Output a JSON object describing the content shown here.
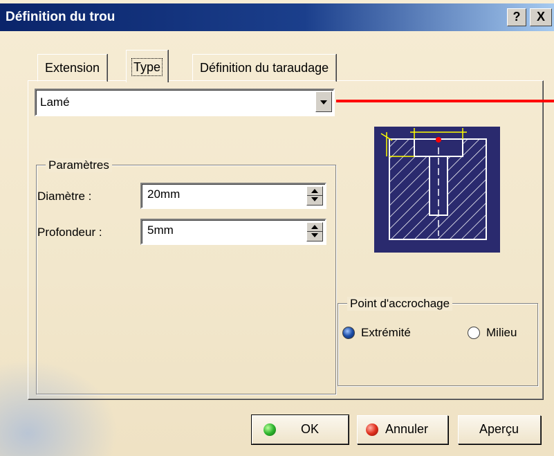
{
  "window": {
    "title": "Définition du trou",
    "help_label": "?",
    "close_label": "X"
  },
  "tabs": [
    {
      "label": "Extension",
      "active": false
    },
    {
      "label": "Type",
      "active": true
    },
    {
      "label": "Définition du taraudage",
      "active": false
    }
  ],
  "type_select": {
    "value": "Lamé"
  },
  "parameters": {
    "group_label": "Paramètres",
    "diameter": {
      "label": "Diamètre :",
      "value": "20mm"
    },
    "depth": {
      "label": "Profondeur :",
      "value": "5mm"
    }
  },
  "anchor_point": {
    "group_label": "Point d'accrochage",
    "options": [
      {
        "label": "Extrémité",
        "checked": true
      },
      {
        "label": "Milieu",
        "checked": false
      }
    ]
  },
  "buttons": {
    "ok_label": "OK",
    "cancel_label": "Annuler",
    "preview_label": "Aperçu"
  },
  "colors": {
    "title_bar": "#0a246a",
    "preview_background": "#2a2a6e",
    "preview_dimension_lines": "#ffff00",
    "preview_anchor": "#ff0000",
    "callout_line": "#ff0000",
    "dialog_background": "#f4ead2"
  }
}
